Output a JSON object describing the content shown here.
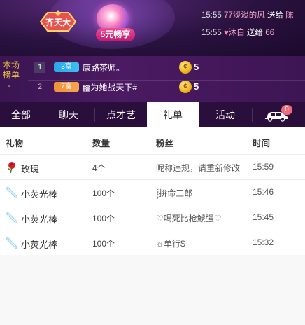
{
  "banner": {
    "badge_text": "齐天大",
    "promo_text": "5元畅享",
    "feed": [
      {
        "time": "15:55",
        "user": "77淡淡的风",
        "action": "送给",
        "target": "陈"
      },
      {
        "time": "15:55",
        "user": "沐白",
        "action": "送给",
        "target": "66"
      }
    ]
  },
  "rank": {
    "label": "本场榜单",
    "rows": [
      {
        "no": "1",
        "level": "3富",
        "name": "康路茶师。",
        "score": "5"
      },
      {
        "no": "2",
        "level": "7富",
        "name": "▩为她战天下#",
        "score": "5"
      }
    ]
  },
  "tabs": {
    "items": [
      "全部",
      "聊天",
      "点才艺",
      "礼单",
      "活动"
    ],
    "active": "礼单",
    "car_badge": "0"
  },
  "gift_list": {
    "headers": {
      "gift": "礼物",
      "qty": "数量",
      "fan": "粉丝",
      "time": "时间"
    },
    "rows": [
      {
        "gift": "玫瑰",
        "icon": "rose-icon",
        "qty": "4个",
        "fan": "昵称违规，请重新修改",
        "time": "15:59"
      },
      {
        "gift": "小荧光棒",
        "icon": "glow-stick-icon",
        "qty": "100个",
        "fan": "⸾拚命三郎",
        "time": "15:46"
      },
      {
        "gift": "小荧光棒",
        "icon": "glow-stick-icon",
        "qty": "100个",
        "fan": "♡喝死比枪鯱强♡",
        "time": "15:45"
      },
      {
        "gift": "小荧光棒",
        "icon": "glow-stick-icon",
        "qty": "100个",
        "fan": "☼单行$",
        "time": "15:32"
      }
    ]
  },
  "colors": {
    "tab_bar": "#2a0f3c",
    "rank_panel": "#4b1a62",
    "accent_pink": "#f24c94"
  }
}
